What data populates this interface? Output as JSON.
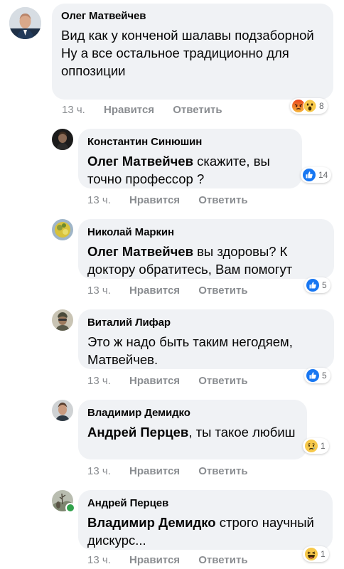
{
  "colors": {
    "bubble": "#f0f2f5",
    "meta_text": "#8a8d91",
    "like_blue": "#1877f2",
    "online_green": "#31a24c"
  },
  "comments": [
    {
      "author": "Олег Матвейчев",
      "mention": "",
      "text": "Вид как у конченой шалавы подзаборной\n Ну а все остальное традиционно для оппозиции",
      "time": "13 ч.",
      "like_label": "Нравится",
      "reply_label": "Ответить",
      "reactions": [
        "angry-icon",
        "wow-icon"
      ],
      "reaction_count": "8"
    },
    {
      "author": "Константин Синюшин",
      "mention": "Олег Матвейчев",
      "text": " скажите, вы точно профессор ?",
      "time": "13 ч.",
      "like_label": "Нравится",
      "reply_label": "Ответить",
      "reactions": [
        "like-icon"
      ],
      "reaction_count": "14"
    },
    {
      "author": "Николай Маркин",
      "mention": "Олег Матвейчев",
      "text": " вы здоровы? К доктору обратитесь, Вам помогут",
      "time": "13 ч.",
      "like_label": "Нравится",
      "reply_label": "Ответить",
      "reactions": [
        "like-icon"
      ],
      "reaction_count": "5"
    },
    {
      "author": "Виталий Лифар",
      "mention": "",
      "text": "Это ж надо быть таким негодяем, Матвейчев.",
      "time": "13 ч.",
      "like_label": "Нравится",
      "reply_label": "Ответить",
      "reactions": [
        "like-icon"
      ],
      "reaction_count": "5"
    },
    {
      "author": "Владимир Демидко",
      "mention": "Андрей Перцев",
      "text": ", ты такое любиш",
      "time": "13 ч.",
      "like_label": "Нравится",
      "reply_label": "Ответить",
      "reactions": [
        "sad-icon"
      ],
      "reaction_count": "1"
    },
    {
      "author": "Андрей Перцев",
      "mention": "Владимир Демидко",
      "text": " строго научный дискурс...",
      "time": "13 ч.",
      "like_label": "Нравится",
      "reply_label": "Ответить",
      "reactions": [
        "haha-icon"
      ],
      "reaction_count": "1"
    }
  ]
}
